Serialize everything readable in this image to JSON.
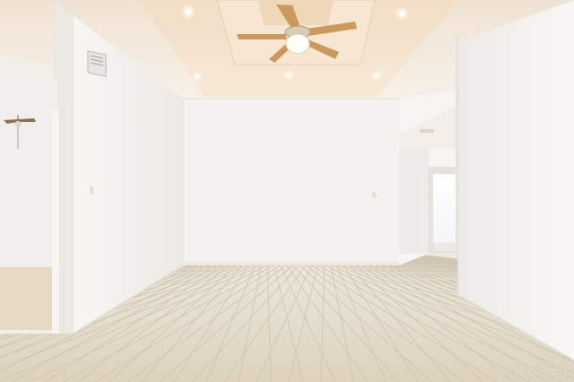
{
  "scene": {
    "kind": "photo",
    "subject": "empty-room-interior",
    "watermark": "GREATER ALLEN",
    "palette": {
      "ceiling": "#f4ebe0",
      "tray_ceiling": "#f1dcc4",
      "wall_left": "#f2efea",
      "wall_back": "#f5f3ef",
      "wall_right": "#f6f4f1",
      "floor_tile": "#e4dcc8",
      "grout": "#c9bfa9",
      "fan_blade": "#c99a5c"
    }
  }
}
